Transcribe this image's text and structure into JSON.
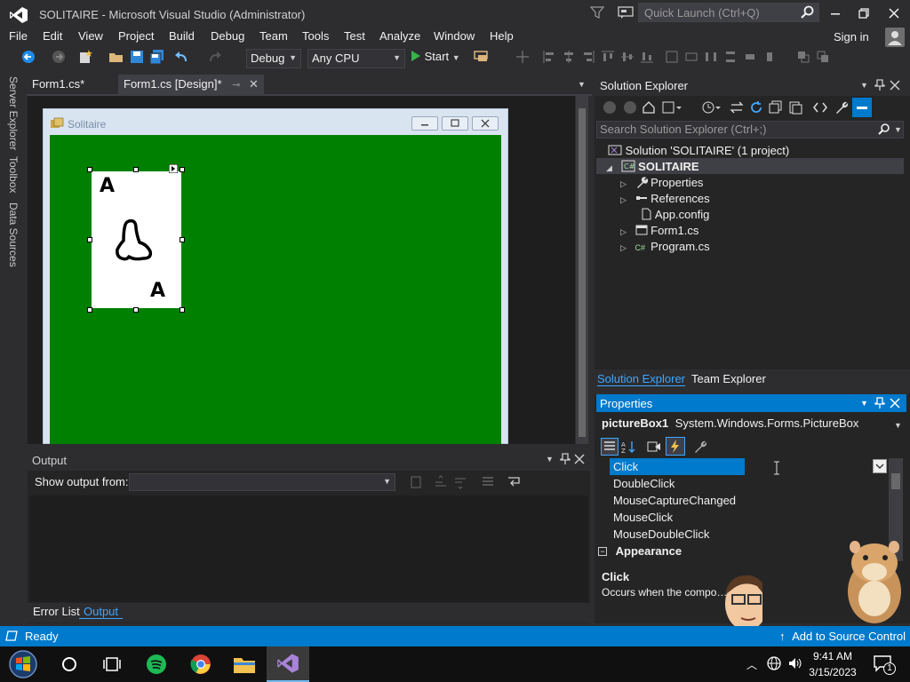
{
  "window": {
    "title": "SOLITAIRE - Microsoft Visual Studio  (Administrator)"
  },
  "quick_launch": {
    "placeholder": "Quick Launch (Ctrl+Q)"
  },
  "menu": [
    "File",
    "Edit",
    "View",
    "Project",
    "Build",
    "Debug",
    "Team",
    "Tools",
    "Test",
    "Analyze",
    "Window",
    "Help"
  ],
  "account": {
    "signin": "Sign in"
  },
  "toolbar": {
    "config": "Debug",
    "platform": "Any CPU",
    "start": "Start"
  },
  "left_dock": [
    "Server Explorer",
    "Toolbox",
    "Data Sources"
  ],
  "doc_tabs": [
    {
      "label": "Form1.cs*",
      "active": false
    },
    {
      "label": "Form1.cs [Design]*",
      "active": true
    }
  ],
  "designer": {
    "form_title": "Solitaire",
    "card": {
      "top_rank": "A",
      "bottom_rank": "A"
    },
    "colors": {
      "form_bg": "#008000",
      "card": "#ffffff"
    }
  },
  "output": {
    "title": "Output",
    "show_from_label": "Show output from:",
    "show_from_value": ""
  },
  "bottom_tabs": [
    {
      "label": "Error List",
      "active": false
    },
    {
      "label": "Output",
      "active": true
    }
  ],
  "solution_explorer": {
    "title": "Solution Explorer",
    "search_placeholder": "Search Solution Explorer (Ctrl+;)",
    "tree": {
      "solution": "Solution 'SOLITAIRE' (1 project)",
      "project": "SOLITAIRE",
      "items": [
        "Properties",
        "References",
        "App.config",
        "Form1.cs",
        "Program.cs"
      ]
    },
    "tabs": [
      "Solution Explorer",
      "Team Explorer"
    ]
  },
  "properties": {
    "title": "Properties",
    "object_name": "pictureBox1",
    "object_type": "System.Windows.Forms.PictureBox",
    "events": [
      "Click",
      "DoubleClick",
      "MouseCaptureChanged",
      "MouseClick",
      "MouseDoubleClick"
    ],
    "category": "Appearance",
    "description_title": "Click",
    "description_text": "Occurs when the compo…cked."
  },
  "status": {
    "text": "Ready",
    "source_control": "Add to Source Control"
  },
  "clock": {
    "time": "9:41 AM",
    "date": "3/15/2023"
  },
  "notifications": {
    "count": "1"
  },
  "colors": {
    "accent": "#007acc",
    "bg": "#2d2d30",
    "selection": "#3f3f46"
  }
}
